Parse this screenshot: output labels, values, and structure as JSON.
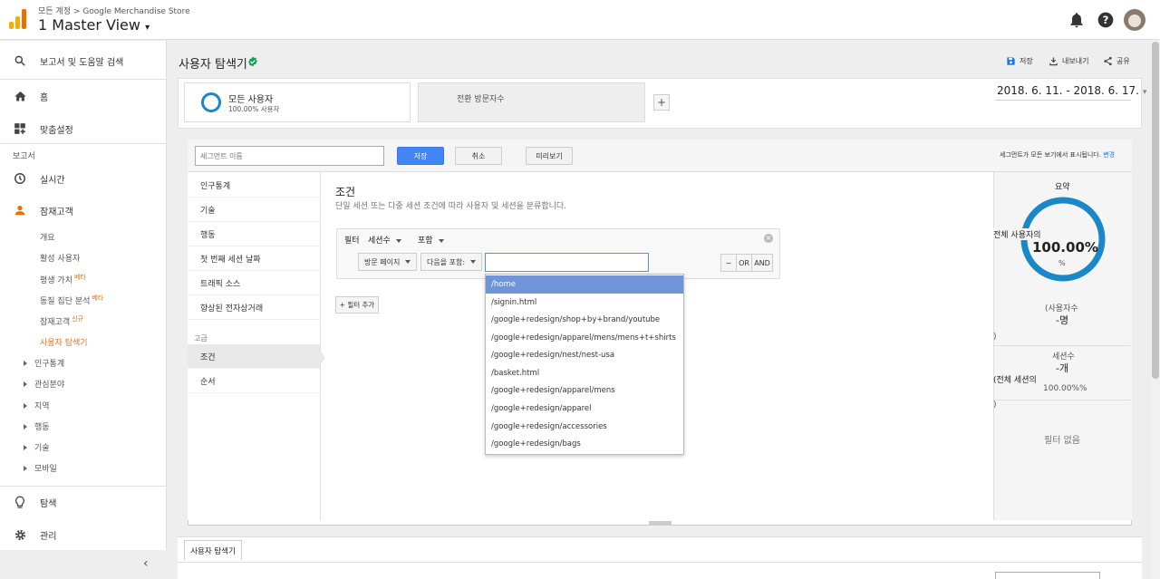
{
  "header": {
    "breadcrumb": "모든 계정 > Google Merchandise Store",
    "view_name": "1 Master View"
  },
  "sidebar": {
    "search": "보고서 및 도움말 검색",
    "home": "홈",
    "customization": "맞춤설정",
    "reports_label": "보고서",
    "realtime": "실시간",
    "audience": "잠재고객",
    "audience_items": [
      {
        "label": "개요",
        "badge": ""
      },
      {
        "label": "활성 사용자",
        "badge": ""
      },
      {
        "label": "평생 가치",
        "badge": "베타"
      },
      {
        "label": "동질 집단 분석",
        "badge": "베타"
      },
      {
        "label": "잠재고객",
        "badge": "신규"
      },
      {
        "label": "사용자 탐색기",
        "badge": ""
      }
    ],
    "tree_items": [
      "인구통계",
      "관심분야",
      "지역",
      "행동",
      "기술",
      "모바일"
    ],
    "discover": "탐색",
    "admin": "관리"
  },
  "main": {
    "title": "사용자 탐색기",
    "actions": {
      "save": "저장",
      "export": "내보내기",
      "share": "공유"
    },
    "segments": {
      "all_users": "모든 사용자",
      "all_users_pct": "100.00% 사용자",
      "conversion": "전환 방문자수"
    },
    "date_range": "2018. 6. 11. - 2018. 6. 17."
  },
  "builder": {
    "name_placeholder": "세그먼트 이름",
    "save": "저장",
    "cancel": "취소",
    "preview": "미리보기",
    "notice": "세그먼트가 모든 보기에서 표시됩니다.",
    "change": "변경",
    "categories": [
      "인구통계",
      "기술",
      "행동",
      "첫 번째 세션 날짜",
      "트래픽 소스",
      "향상된 전자상거래"
    ],
    "advanced_label": "고급",
    "advanced": [
      "조건",
      "순서"
    ],
    "conditions_title": "조건",
    "conditions_desc": "단일 세션 또는 다중 세션 조건에 따라 사용자 및 세션을 분류합니다.",
    "filter_label": "필터",
    "filter_scope": "세션수",
    "filter_include": "포함",
    "dim": "방문 페이지",
    "op": "다음을 포함:",
    "minus": "−",
    "or": "OR",
    "and": "AND",
    "add_filter": "+ 필터 추가",
    "suggestions": [
      "/home",
      "/signin.html",
      "/google+redesign/shop+by+brand/youtube",
      "/google+redesign/apparel/mens/mens+t+shirts",
      "/google+redesign/nest/nest-usa",
      "/basket.html",
      "/google+redesign/apparel/mens",
      "/google+redesign/apparel",
      "/google+redesign/accessories",
      "/google+redesign/bags"
    ]
  },
  "summary": {
    "title": "요약",
    "ring_label": "전체 사용자의",
    "ring_value": "100.00%",
    "ring_unit": "%",
    "users_label": "(사용자수",
    "users_value": "-명",
    "paren1": ")",
    "sessions_label": "세션수",
    "sessions_value": "-개",
    "sessions_all": "(전체 세션의",
    "sessions_pct": "100.00%%",
    "paren2": ")",
    "no_filter": "필터 없음"
  },
  "bottom": {
    "tab": "사용자 탐색기"
  },
  "colors": {
    "accent_orange": "#e8710a",
    "blue": "#4285f4",
    "ring": "#1a87c9"
  }
}
